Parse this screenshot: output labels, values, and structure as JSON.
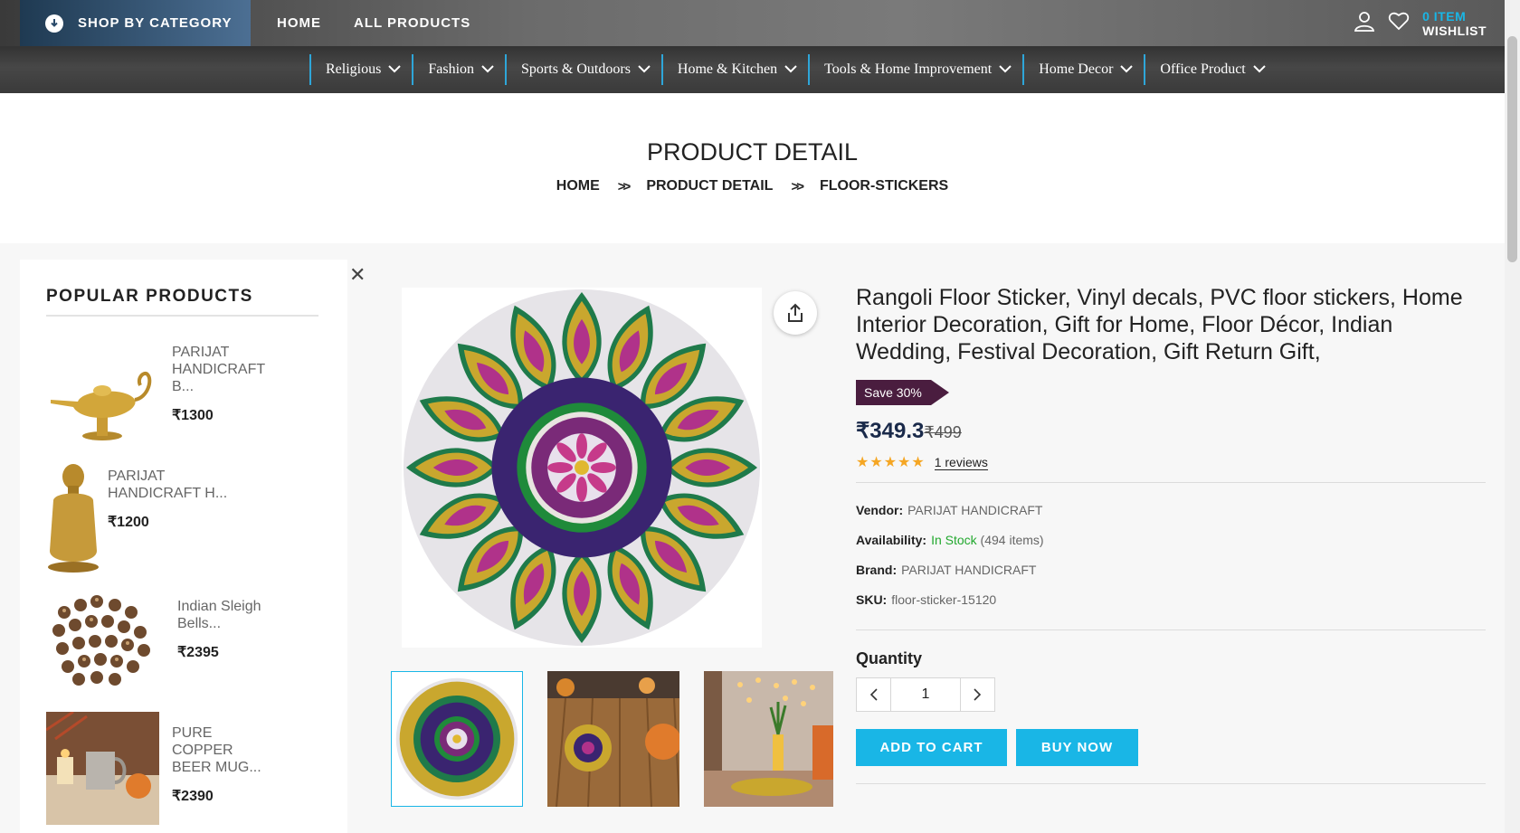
{
  "header": {
    "shop_by_category": "SHOP BY CATEGORY",
    "nav": [
      "HOME",
      "ALL PRODUCTS"
    ],
    "wishlist_count": "0 ITEM",
    "wishlist_label": "WISHLIST"
  },
  "categories": [
    "Religious",
    "Fashion",
    "Sports & Outdoors",
    "Home & Kitchen",
    "Tools & Home Improvement",
    "Home Decor",
    "Office Product"
  ],
  "page": {
    "title": "PRODUCT DETAIL",
    "breadcrumb": [
      "HOME",
      "PRODUCT DETAIL",
      "FLOOR-STICKERS"
    ]
  },
  "sidebar": {
    "title": "POPULAR PRODUCTS",
    "products": [
      {
        "name": "PARIJAT HANDICRAFT B...",
        "price": "₹1300"
      },
      {
        "name": "PARIJAT HANDICRAFT H...",
        "price": "₹1200"
      },
      {
        "name": "Indian Sleigh Bells...",
        "price": "₹2395"
      },
      {
        "name": "PURE COPPER BEER MUG...",
        "price": "₹2390"
      }
    ]
  },
  "product": {
    "title": "Rangoli Floor Sticker, Vinyl decals, PVC floor stickers, Home Interior Decoration, Gift for Home, Floor Décor, Indian Wedding, Festival Decoration, Gift Return Gift,",
    "save_badge": "Save 30%",
    "price": "₹349.3",
    "old_price": "₹499",
    "rating": 5,
    "reviews": "1 reviews",
    "vendor_label": "Vendor:",
    "vendor": "PARIJAT HANDICRAFT",
    "availability_label": "Availability:",
    "availability": "In Stock",
    "availability_count": "(494 items)",
    "brand_label": "Brand:",
    "brand": "PARIJAT HANDICRAFT",
    "sku_label": "SKU:",
    "sku": "floor-sticker-15120",
    "quantity_label": "Quantity",
    "quantity": "1",
    "add_to_cart": "ADD TO CART",
    "buy_now": "BUY NOW"
  },
  "icons": {
    "accent": "#19b6e6",
    "badge": "#4a1d3f",
    "stock": "#22a82e",
    "star": "#f5a623"
  }
}
